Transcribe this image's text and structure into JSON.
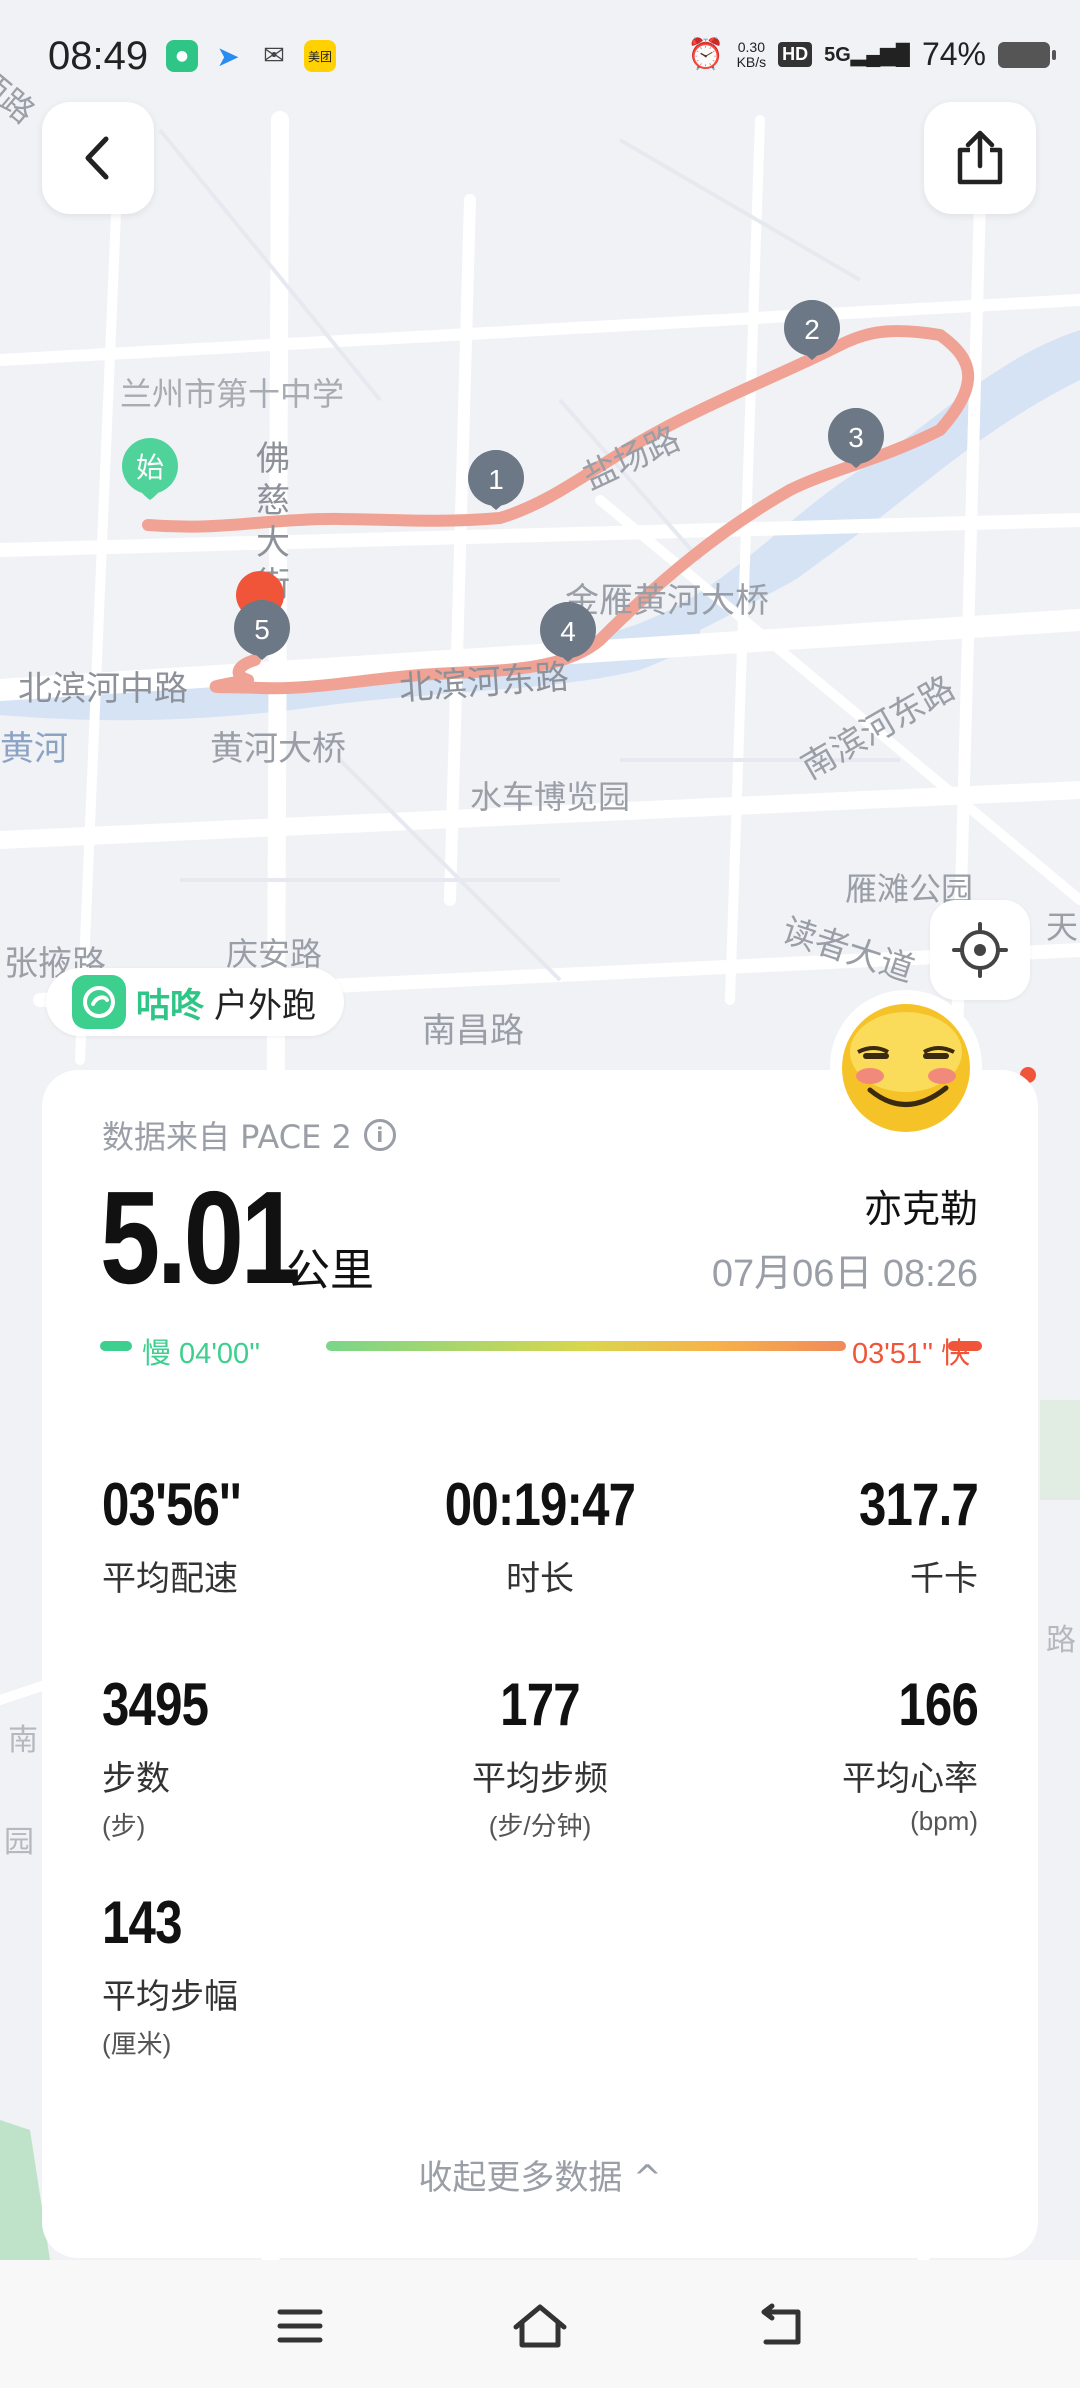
{
  "status_bar": {
    "time": "08:49",
    "net_speed": "0.30",
    "net_unit": "KB/s",
    "hd": "HD",
    "signal": "5G",
    "battery": "74%",
    "meituan": "美团"
  },
  "map": {
    "labels": [
      {
        "text": "兰州市第十中学"
      },
      {
        "text": "佛"
      },
      {
        "text": "慈"
      },
      {
        "text": "大"
      },
      {
        "text": "街"
      },
      {
        "text": "盐场路"
      },
      {
        "text": "金雁黄河大桥"
      },
      {
        "text": "北滨河中路"
      },
      {
        "text": "北滨河东路"
      },
      {
        "text": "黄河"
      },
      {
        "text": "黄河大桥"
      },
      {
        "text": "水车博览园"
      },
      {
        "text": "南滨河东路"
      },
      {
        "text": "雁滩公园"
      },
      {
        "text": "读者大道"
      },
      {
        "text": "张掖路"
      },
      {
        "text": "庆安路"
      },
      {
        "text": "南昌路"
      },
      {
        "text": "西路"
      },
      {
        "text": "天"
      },
      {
        "text": "兰"
      },
      {
        "text": "路"
      },
      {
        "text": "南"
      },
      {
        "text": "园"
      }
    ],
    "start_marker": "始",
    "km_markers": [
      "1",
      "2",
      "3",
      "4",
      "5"
    ],
    "route_color": "#f0a394"
  },
  "badge": {
    "brand": "咕咚",
    "activity": "户外跑"
  },
  "summary": {
    "source": "数据来自 PACE 2",
    "info_icon_glyph": "i",
    "distance": "5.01",
    "distance_unit": "公里",
    "user": "亦克勒",
    "datetime": "07月06日 08:26",
    "slow_label": "慢 04'00''",
    "fast_label": "03'51'' 快"
  },
  "metrics": [
    {
      "value": "03'56''",
      "label": "平均配速",
      "sub": ""
    },
    {
      "value": "00:19:47",
      "label": "时长",
      "sub": ""
    },
    {
      "value": "317.7",
      "label": "千卡",
      "sub": ""
    },
    {
      "value": "3495",
      "label": "步数",
      "sub": "(步)"
    },
    {
      "value": "177",
      "label": "平均步频",
      "sub": "(步/分钟)"
    },
    {
      "value": "166",
      "label": "平均心率",
      "sub": "(bpm)"
    },
    {
      "value": "143",
      "label": "平均步幅",
      "sub": "(厘米)"
    }
  ],
  "collapse_text": "收起更多数据 ^",
  "colors": {
    "accent_green": "#2fc587",
    "slow": "#3ccf8e",
    "fast": "#f0553a"
  }
}
